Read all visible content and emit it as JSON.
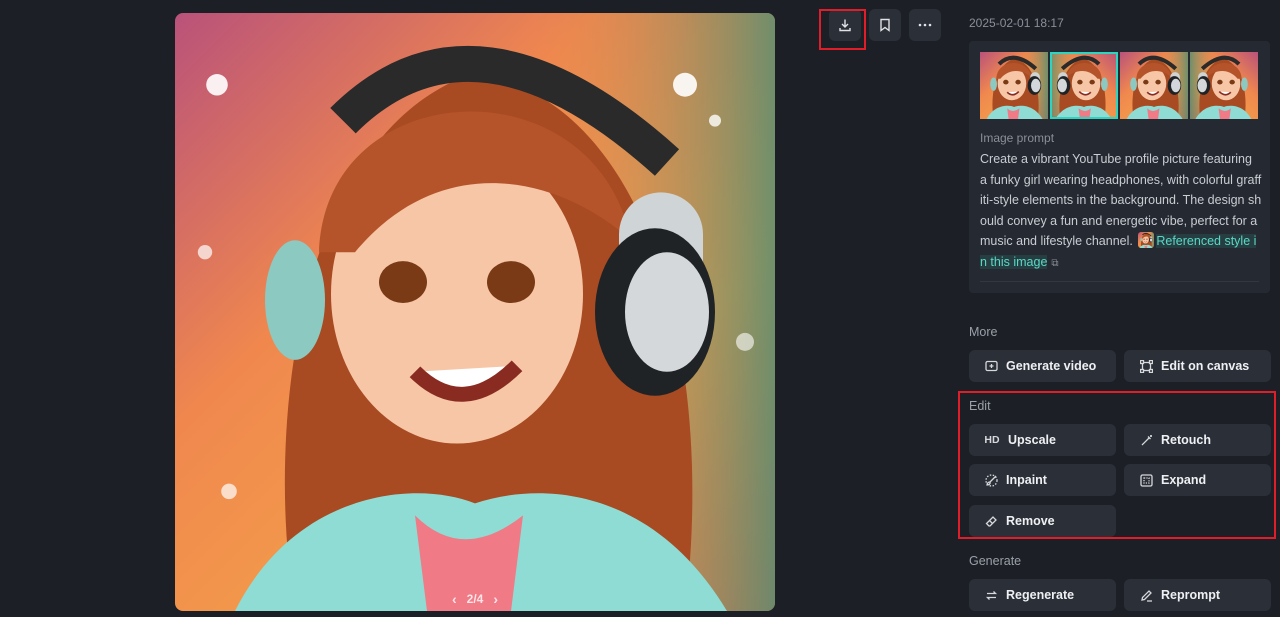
{
  "image_viewer": {
    "pager": {
      "current": "2/4",
      "prev_icon": "chevron-left-icon",
      "next_icon": "chevron-right-icon"
    }
  },
  "toolbar": {
    "download_icon": "download-icon",
    "bookmark_icon": "bookmark-icon",
    "more_icon": "more-horizontal-icon",
    "highlight_color": "#e01e2a"
  },
  "details": {
    "timestamp": "2025-02-01 18:17",
    "prompt_label": "Image prompt",
    "prompt_text": "Create a vibrant YouTube profile picture featuring a funky girl wearing headphones, with colorful graffiti-style elements in the background. The design should convey a fun and energetic vibe, perfect for a music and lifestyle channel.",
    "reference_link": "Referenced style in this image",
    "accent_color": "#2fd4c0"
  },
  "more": {
    "label": "More",
    "buttons": [
      {
        "label": "Generate video",
        "icon": "video-plus-icon"
      },
      {
        "label": "Edit on canvas",
        "icon": "canvas-frame-icon"
      }
    ]
  },
  "edit": {
    "label": "Edit",
    "buttons": [
      {
        "label": "Upscale",
        "icon": "HD"
      },
      {
        "label": "Retouch",
        "icon": "magic-wand-icon"
      },
      {
        "label": "Inpaint",
        "icon": "brush-icon"
      },
      {
        "label": "Expand",
        "icon": "expand-icon"
      },
      {
        "label": "Remove",
        "icon": "eraser-icon"
      }
    ]
  },
  "generate": {
    "label": "Generate",
    "buttons": [
      {
        "label": "Regenerate",
        "icon": "refresh-icon"
      },
      {
        "label": "Reprompt",
        "icon": "pencil-icon"
      }
    ]
  }
}
